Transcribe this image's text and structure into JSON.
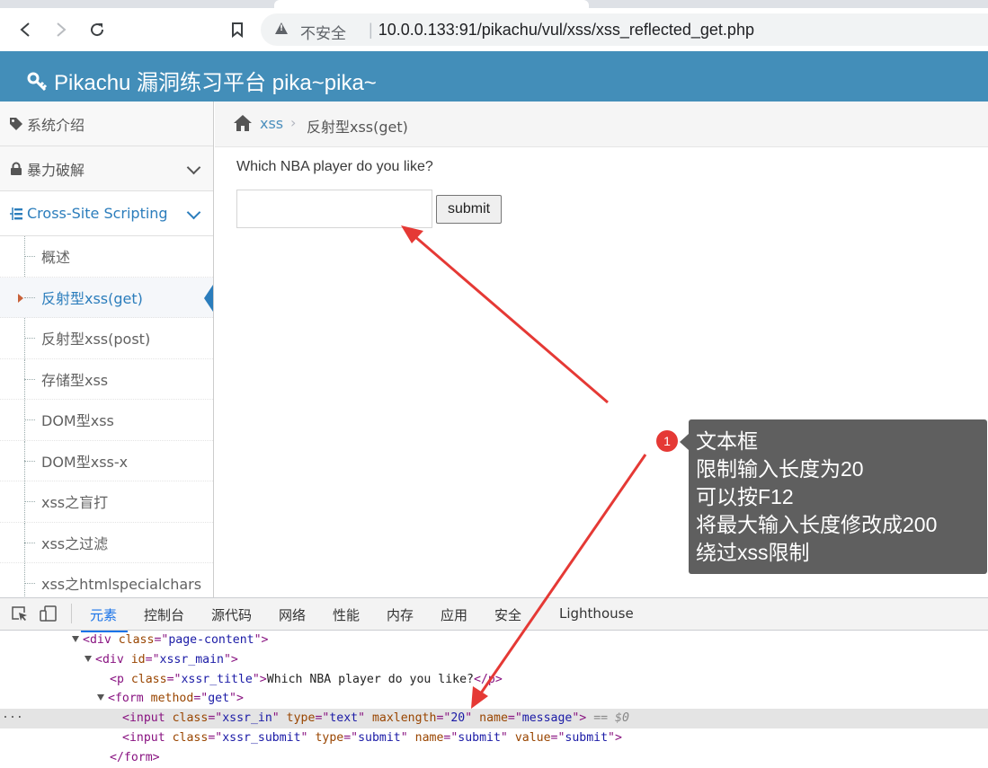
{
  "browser": {
    "security_label": "不安全",
    "url": "10.0.0.133:91/pikachu/vul/xss/xss_reflected_get.php"
  },
  "header": {
    "title": "Pikachu 漏洞练习平台 pika~pika~"
  },
  "sidebar": {
    "items": [
      {
        "label": "系统介绍",
        "icon": "tag-icon"
      },
      {
        "label": "暴力破解",
        "icon": "lock-icon"
      },
      {
        "label": "Cross-Site Scripting",
        "icon": "list-tree-icon"
      }
    ],
    "sub_items": [
      {
        "label": "概述"
      },
      {
        "label": "反射型xss(get)"
      },
      {
        "label": "反射型xss(post)"
      },
      {
        "label": "存储型xss"
      },
      {
        "label": "DOM型xss"
      },
      {
        "label": "DOM型xss-x"
      },
      {
        "label": "xss之盲打"
      },
      {
        "label": "xss之过滤"
      },
      {
        "label": "xss之htmlspecialchars"
      }
    ]
  },
  "breadcrumb": {
    "link": "xss",
    "current": "反射型xss(get)"
  },
  "form": {
    "question": "Which NBA player do you like?",
    "submit_label": "submit"
  },
  "annotation": {
    "badge": "1",
    "lines": [
      "文本框",
      "限制输入长度为20",
      "可以按F12",
      "将最大输入长度修改成200",
      "绕过xss限制"
    ],
    "color": "#e53935"
  },
  "devtools": {
    "tabs": [
      "元素",
      "控制台",
      "源代码",
      "网络",
      "性能",
      "内存",
      "应用",
      "安全",
      "Lighthouse"
    ],
    "active_tab": "元素",
    "code": {
      "l1_tag": "div",
      "l1_attr": "class",
      "l1_val": "page-content",
      "l2_tag": "div",
      "l2_attr": "id",
      "l2_val": "xssr_main",
      "l3_tag": "p",
      "l3_attr": "class",
      "l3_val": "xssr_title",
      "l3_text": "Which NBA player do you like?",
      "l4_tag": "form",
      "l4_attr": "method",
      "l4_val": "get",
      "l5_tag": "input",
      "l5_a1": "class",
      "l5_v1": "xssr_in",
      "l5_a2": "type",
      "l5_v2": "text",
      "l5_a3": "maxlength",
      "l5_v3": "20",
      "l5_a4": "name",
      "l5_v4": "message",
      "l5_suffix": " == $0",
      "l6_tag": "input",
      "l6_a1": "class",
      "l6_v1": "xssr_submit",
      "l6_a2": "type",
      "l6_v2": "submit",
      "l6_a3": "name",
      "l6_v3": "submit",
      "l6_a4": "value",
      "l6_v4": "submit",
      "l7_tag": "/form"
    }
  }
}
